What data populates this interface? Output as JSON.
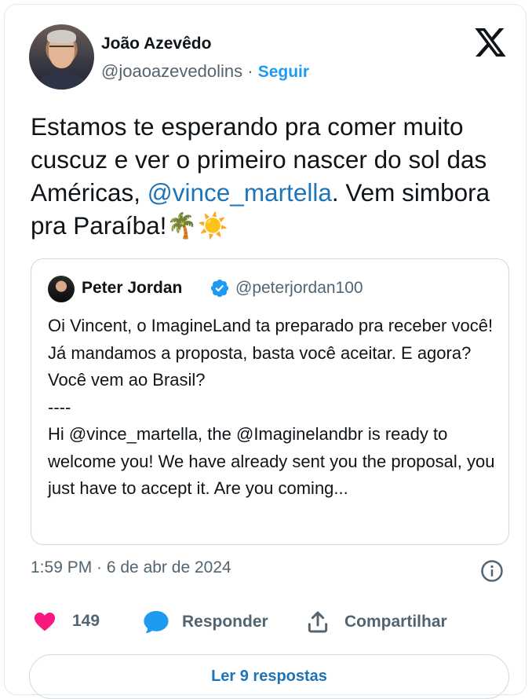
{
  "author": {
    "name": "João Azevêdo",
    "handle": "@joaoazevedolins",
    "separator": "·",
    "follow_label": "Seguir"
  },
  "tweet": {
    "text_before_mention": "Estamos te esperando pra comer muito cuscuz e ver o primeiro nascer do sol das Américas, ",
    "mention": "@vince_martella",
    "text_after_mention": ". Vem simbora pra Paraíba!",
    "emojis": "🌴☀️"
  },
  "quoted": {
    "name": "Peter Jordan",
    "handle": "@peterjordan100",
    "body": "Oi Vincent, o ImagineLand ta preparado pra receber você! Já mandamos a proposta, basta você aceitar. E agora? Você vem ao Brasil?\n----\nHi @vince_martella, the @Imaginelandbr is ready to welcome you! We have already sent you the proposal, you just have to accept it. Are you coming..."
  },
  "timestamp": "1:59 PM · 6 de abr de 2024",
  "actions": {
    "like_count": "149",
    "reply_label": "Responder",
    "share_label": "Compartilhar"
  },
  "read_replies_label": "Ler 9 respostas",
  "icons": [
    "x-logo-icon",
    "verified-badge-icon",
    "info-icon",
    "heart-icon",
    "reply-bubble-icon",
    "share-icon"
  ],
  "colors": {
    "accent": "#1d9bf0",
    "link": "#1d74b8",
    "like": "#f91880",
    "secondary_text": "#536471",
    "border": "#cfd9de"
  }
}
